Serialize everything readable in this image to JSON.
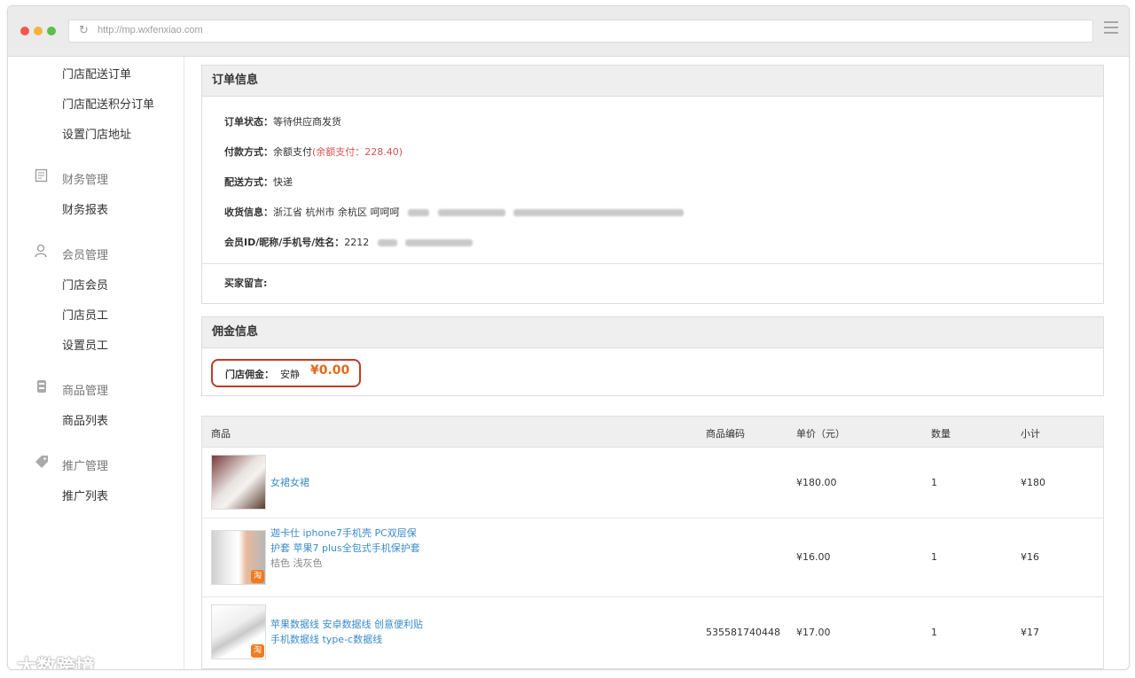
{
  "browser": {
    "url": "http://mp.wxfenxiao.com"
  },
  "sidebar": {
    "items_top": [
      "门店配送订单",
      "门店配送积分订单",
      "设置门店地址"
    ],
    "groups": [
      {
        "title": "财务管理",
        "icon": "finance-icon",
        "items": [
          "财务报表"
        ]
      },
      {
        "title": "会员管理",
        "icon": "member-icon",
        "items": [
          "门店会员",
          "门店员工",
          "设置员工"
        ]
      },
      {
        "title": "商品管理",
        "icon": "goods-icon",
        "items": [
          "商品列表"
        ]
      },
      {
        "title": "推广管理",
        "icon": "tag-icon",
        "items": [
          "推广列表"
        ]
      }
    ]
  },
  "order": {
    "title": "订单信息",
    "status_label": "订单状态：",
    "status_value": "等待供应商发货",
    "pay_label": "付款方式：",
    "pay_value": "余额支付",
    "pay_detail": "(余额支付：228.40)",
    "ship_label": "配送方式：",
    "ship_value": "快递",
    "addr_label": "收货信息：",
    "addr_value": "浙江省 杭州市 余杭区 呵呵呵",
    "member_label": "会员ID/昵称/手机号/姓名：",
    "member_id": "2212",
    "note_label": "买家留言:"
  },
  "commission": {
    "title": "佣金信息",
    "label": "门店佣金：",
    "name": "安静",
    "amount": "¥0.00"
  },
  "table": {
    "headers": {
      "product": "商品",
      "code": "商品编码",
      "price": "单价（元）",
      "qty": "数量",
      "subtotal": "小计"
    },
    "rows": [
      {
        "name": "女裙女裙",
        "spec": "",
        "code": "",
        "price": "¥180.00",
        "qty": "1",
        "subtotal": "¥180"
      },
      {
        "name": "迦卡仕 iphone7手机壳 PC双层保护套 苹果7 plus全包式手机保护套",
        "spec": "桔色 浅灰色",
        "code": "",
        "price": "¥16.00",
        "qty": "1",
        "subtotal": "¥16"
      },
      {
        "name": "苹果数据线 安卓数据线 创意便利贴手机数据线 type-c数据线",
        "spec": "",
        "code": "535581740448",
        "price": "¥17.00",
        "qty": "1",
        "subtotal": "¥17"
      }
    ],
    "tao_badge": "淘"
  },
  "watermark": "大数跨境"
}
